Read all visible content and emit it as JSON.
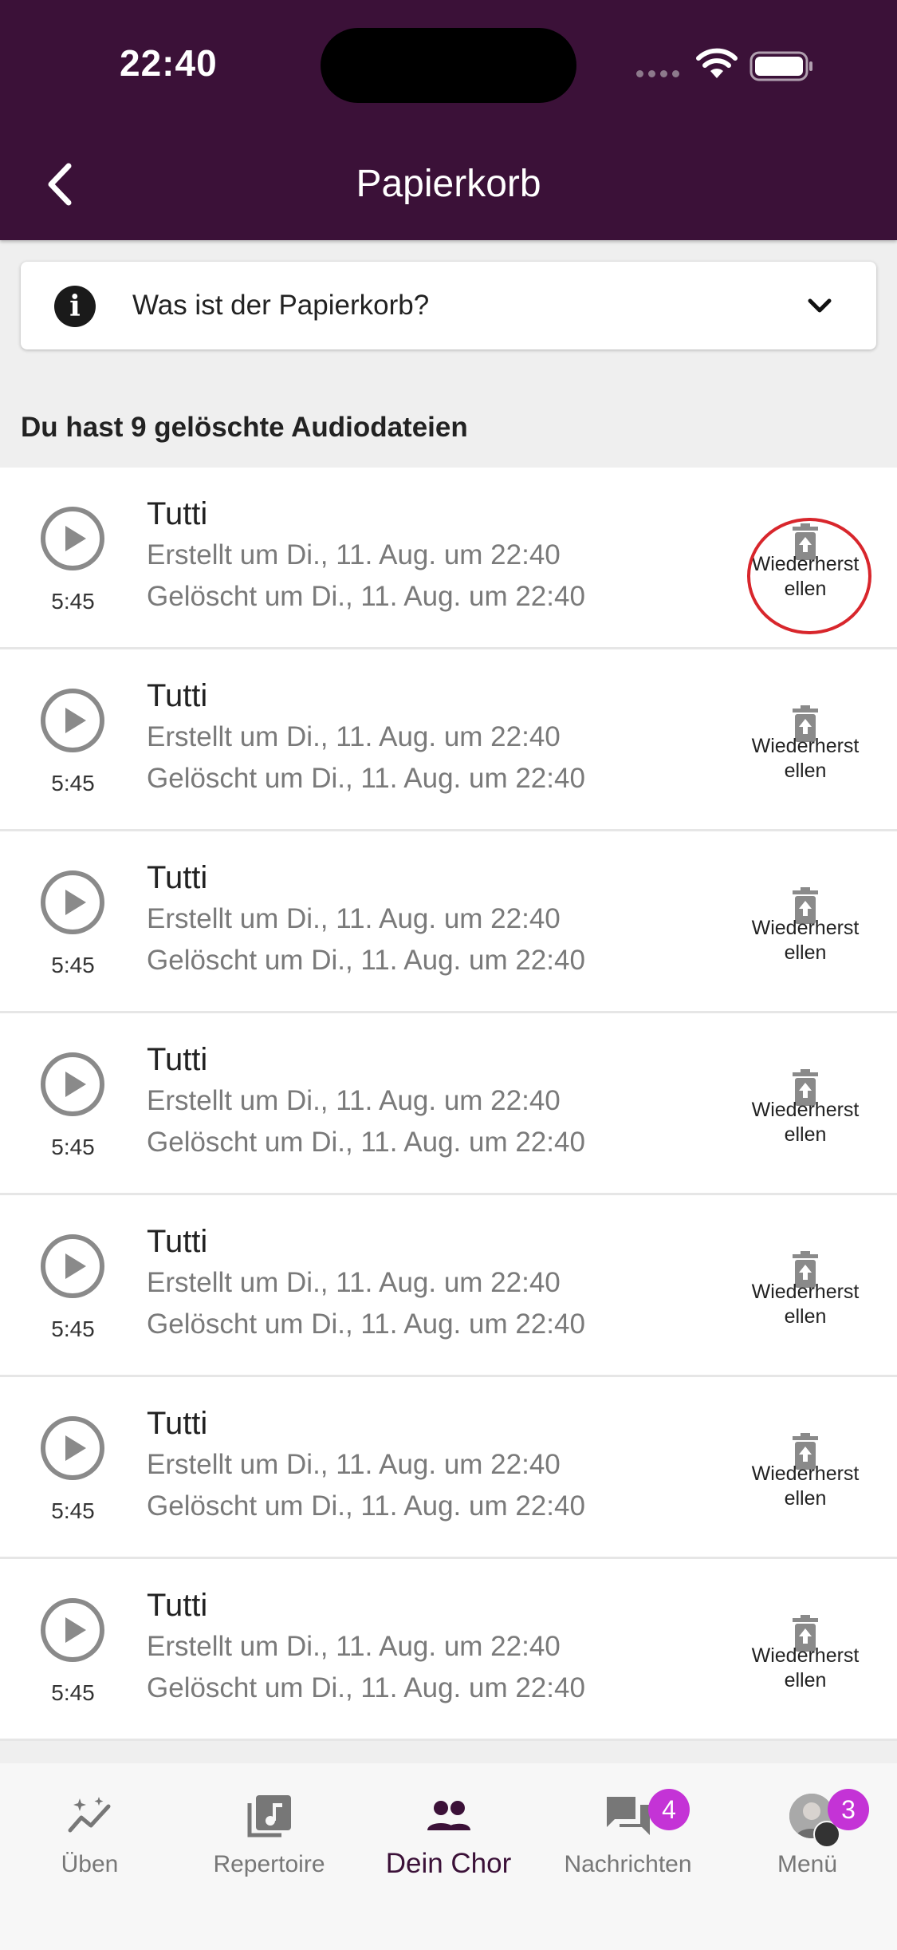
{
  "status_bar": {
    "time": "22:40"
  },
  "header": {
    "title": "Papierkorb",
    "back_icon": "chevron-left-icon"
  },
  "info": {
    "label": "Was ist der Papierkorb?",
    "icon": "info-icon",
    "expand_icon": "chevron-down-icon"
  },
  "section_title": "Du hast 9 gelöschte Audiodateien",
  "restore_label": "Wiederherstellen",
  "items": [
    {
      "title": "Tutti",
      "duration": "5:45",
      "created": "Erstellt um Di., 11. Aug. um 22:40",
      "deleted": "Gelöscht um Di., 11. Aug. um 22:40",
      "restore_label": "Wiederherst ellen"
    },
    {
      "title": "Tutti",
      "duration": "5:45",
      "created": "Erstellt um Di., 11. Aug. um 22:40",
      "deleted": "Gelöscht um Di., 11. Aug. um 22:40",
      "restore_label": "Wiederherst ellen"
    },
    {
      "title": "Tutti",
      "duration": "5:45",
      "created": "Erstellt um Di., 11. Aug. um 22:40",
      "deleted": "Gelöscht um Di., 11. Aug. um 22:40",
      "restore_label": "Wiederherst ellen"
    },
    {
      "title": "Tutti",
      "duration": "5:45",
      "created": "Erstellt um Di., 11. Aug. um 22:40",
      "deleted": "Gelöscht um Di., 11. Aug. um 22:40",
      "restore_label": "Wiederherst ellen"
    },
    {
      "title": "Tutti",
      "duration": "5:45",
      "created": "Erstellt um Di., 11. Aug. um 22:40",
      "deleted": "Gelöscht um Di., 11. Aug. um 22:40",
      "restore_label": "Wiederherst ellen"
    },
    {
      "title": "Tutti",
      "duration": "5:45",
      "created": "Erstellt um Di., 11. Aug. um 22:40",
      "deleted": "Gelöscht um Di., 11. Aug. um 22:40",
      "restore_label": "Wiederherst ellen"
    },
    {
      "title": "Tutti",
      "duration": "5:45",
      "created": "Erstellt um Di., 11. Aug. um 22:40",
      "deleted": "Gelöscht um Di., 11. Aug. um 22:40",
      "restore_label": "Wiederherst ellen"
    }
  ],
  "nav": {
    "tabs": [
      {
        "label": "Üben",
        "icon": "sparkle-chart-icon"
      },
      {
        "label": "Repertoire",
        "icon": "music-note-icon"
      },
      {
        "label": "Dein Chor",
        "icon": "group-icon",
        "active": true
      },
      {
        "label": "Nachrichten",
        "icon": "chat-icon",
        "badge": "4"
      },
      {
        "label": "Menü",
        "icon": "avatar-icon",
        "badge": "3"
      }
    ]
  },
  "colors": {
    "header_bg": "#3b1138",
    "badge": "#c433d6",
    "highlight": "#d8262c"
  }
}
